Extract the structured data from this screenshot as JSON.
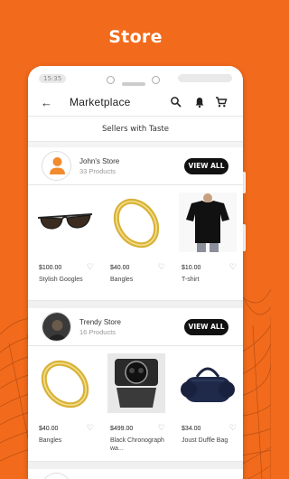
{
  "page": {
    "title": "Store"
  },
  "status": {
    "time": "15:35"
  },
  "appbar": {
    "title": "Marketplace"
  },
  "section": {
    "heading": "Sellers with Taste"
  },
  "sellers": [
    {
      "name": "John's Store",
      "count": "33 Products",
      "button": "VIEW ALL",
      "products": [
        {
          "price": "$100.00",
          "name": "Stylish Googles"
        },
        {
          "price": "$40.00",
          "name": "Bangles"
        },
        {
          "price": "$10.00",
          "name": "T-shirt"
        }
      ]
    },
    {
      "name": "Trendy Store",
      "count": "16 Products",
      "button": "VIEW ALL",
      "products": [
        {
          "price": "$40.00",
          "name": "Bangles"
        },
        {
          "price": "$499.00",
          "name": "Black Chronograph wa..."
        },
        {
          "price": "$34.00",
          "name": "Joust Duffle Bag"
        }
      ]
    }
  ],
  "colors": {
    "brand": "#f26a1b",
    "button": "#111111"
  }
}
